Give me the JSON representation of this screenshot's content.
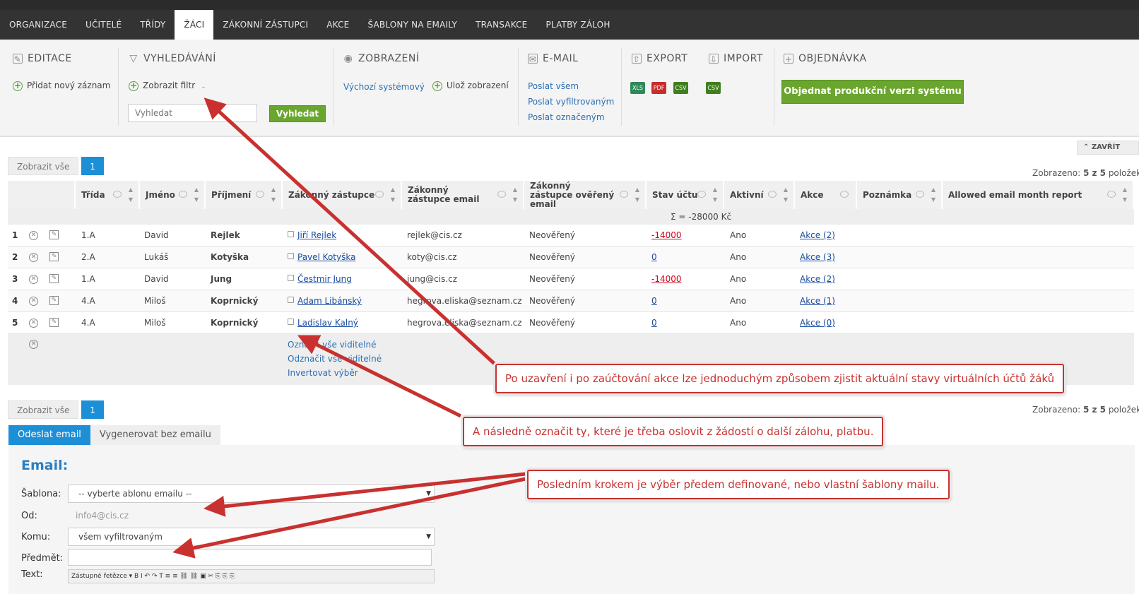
{
  "nav": {
    "items": [
      "ORGANIZACE",
      "UČITELÉ",
      "TŘÍDY",
      "ŽÁCI",
      "ZÁKONNÍ ZÁSTUPCI",
      "AKCE",
      "ŠABLONY NA EMAILY",
      "TRANSAKCE",
      "PLATBY ZÁLOH"
    ],
    "active": "ŽÁCI"
  },
  "toolbar": {
    "editace": {
      "title": "EDITACE",
      "add": "Přidat nový záznam"
    },
    "vyhledavani": {
      "title": "VYHLEDÁVÁNÍ",
      "filter": "Zobrazit filtr",
      "placeholder": "Vyhledat",
      "button": "Vyhledat"
    },
    "zobrazeni": {
      "title": "ZOBRAZENÍ",
      "default": "Výchozí systémový",
      "save": "Ulož zobrazení"
    },
    "email": {
      "title": "E-MAIL",
      "all": "Poslat všem",
      "filtered": "Poslat vyfiltrovaným",
      "marked": "Poslat označeným"
    },
    "export": {
      "title": "EXPORT",
      "formats": [
        "XLS",
        "PDF",
        "CSV"
      ]
    },
    "import": {
      "title": "IMPORT",
      "formats": [
        "CSV"
      ]
    },
    "objednavka": {
      "title": "OBJEDNÁVKA",
      "button": "Objednat produkční verzi systému"
    }
  },
  "close_label": "ZAVŘÍT",
  "pager": {
    "show_all": "Zobrazit vše",
    "page": "1",
    "count_prefix": "Zobrazeno: ",
    "count_value": "5 z 5",
    "count_suffix": " položek"
  },
  "table": {
    "columns": [
      "Třída",
      "Jméno",
      "Příjmení",
      "Zákonný zástupce",
      "Zákonný zástupce email",
      "Zákonný zástupce ověřený email",
      "Stav účtu",
      "Aktivní",
      "Akce",
      "Poznámka",
      "Allowed email month report"
    ],
    "sum": "Σ = -28000 Kč",
    "rows": [
      {
        "n": "1",
        "trida": "1.A",
        "jmeno": "David",
        "prijmeni": "Rejlek",
        "zastupce": "Jiří Rejlek",
        "email": "rejlek@cis.cz",
        "overeny": "Neověřený",
        "stav": "-14000",
        "aktivni": "Ano",
        "akce": "Akce (2)"
      },
      {
        "n": "2",
        "trida": "2.A",
        "jmeno": "Lukáš",
        "prijmeni": "Kotyška",
        "zastupce": "Pavel Kotyška",
        "email": "koty@cis.cz",
        "overeny": "Neověřený",
        "stav": "0",
        "aktivni": "Ano",
        "akce": "Akce (3)"
      },
      {
        "n": "3",
        "trida": "1.A",
        "jmeno": "David",
        "prijmeni": "Jung",
        "zastupce": "Čestmir Jung",
        "email": "jung@cis.cz",
        "overeny": "Neověřený",
        "stav": "-14000",
        "aktivni": "Ano",
        "akce": "Akce (2)"
      },
      {
        "n": "4",
        "trida": "4.A",
        "jmeno": "Miloš",
        "prijmeni": "Koprnický",
        "zastupce": "Adam Libánský",
        "email": "hegrova.eliska@seznam.cz",
        "overeny": "Neověřený",
        "stav": "0",
        "aktivni": "Ano",
        "akce": "Akce (1)"
      },
      {
        "n": "5",
        "trida": "4.A",
        "jmeno": "Miloš",
        "prijmeni": "Koprnický",
        "zastupce": "Ladislav Kalný",
        "email": "hegrova.eliska@seznam.cz",
        "overeny": "Neověřený",
        "stav": "0",
        "aktivni": "Ano",
        "akce": "Akce (0)"
      }
    ],
    "bulk": [
      "Označit vše viditelné",
      "Odznačit vše viditelné",
      "Invertovat výběr"
    ]
  },
  "email_form": {
    "tabs": [
      "Odeslat email",
      "Vygenerovat bez emailu"
    ],
    "title": "Email:",
    "sablona_label": "Šablona:",
    "sablona_value": "-- vyberte ablonu emailu --",
    "od_label": "Od:",
    "od_value": "info4@cis.cz",
    "komu_label": "Komu:",
    "komu_value": "všem vyfiltrovaným",
    "predmet_label": "Předmět:",
    "text_label": "Text:",
    "editor_first": "Zástupné řetězce"
  },
  "callouts": [
    "Po uzavření i po zaúčtování akce lze jednoduchým způsobem zjistit aktuální stavy virtuálních účtů žáků",
    "A následně označit ty, které je třeba oslovit z žádostí o další zálohu, platbu.",
    "Posledním krokem je výběr předem definované, nebo vlastní šablony mailu."
  ],
  "colors": {
    "accent": "#1d8fd6",
    "green": "#6aa52d",
    "callout": "#c8312f",
    "negative": "#d0021b"
  }
}
